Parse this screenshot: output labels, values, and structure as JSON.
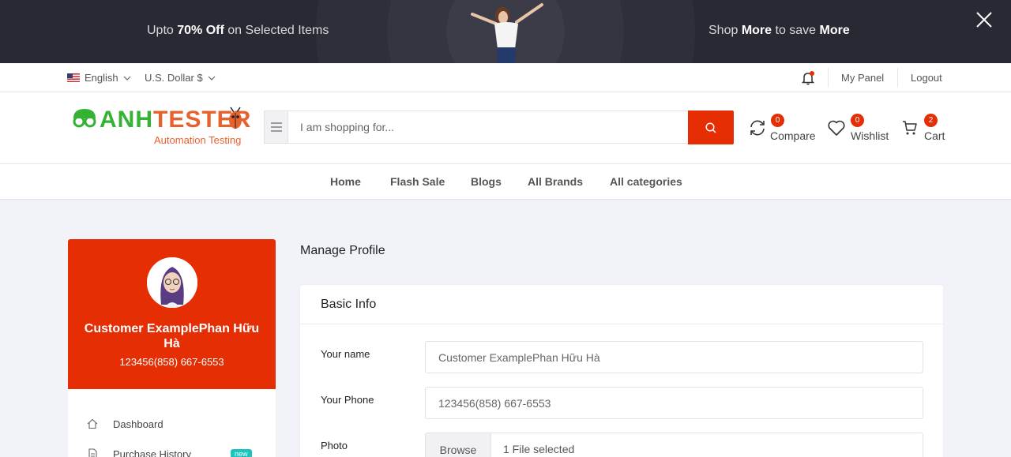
{
  "promo": {
    "left_pre": "Upto ",
    "left_bold": "70% Off",
    "left_post": " on Selected Items",
    "right_pre": "Shop ",
    "right_bold1": "More",
    "right_mid": " to save ",
    "right_bold2": "More"
  },
  "topbar": {
    "language": "English",
    "currency": "U.S. Dollar $",
    "my_panel": "My Panel",
    "logout": "Logout"
  },
  "header": {
    "logo_text_green": "ANH",
    "logo_text_orange": "TESTER",
    "logo_sub": "Automation Testing",
    "search_placeholder": "I am shopping for...",
    "compare_label": "Compare",
    "compare_count": "0",
    "wishlist_label": "Wishlist",
    "wishlist_count": "0",
    "cart_label": "Cart",
    "cart_count": "2"
  },
  "nav": {
    "items": [
      "Home",
      "Flash Sale",
      "Blogs",
      "All Brands",
      "All categories"
    ]
  },
  "sidebar": {
    "name": "Customer ExamplePhan Hữu Hà",
    "phone": "123456(858) 667-6553",
    "items": [
      {
        "label": "Dashboard",
        "icon": "home-icon"
      },
      {
        "label": "Purchase History",
        "icon": "document-icon",
        "badge": "new"
      }
    ]
  },
  "main": {
    "title": "Manage Profile",
    "panel_title": "Basic Info",
    "fields": [
      {
        "label": "Your name",
        "value": "Customer ExamplePhan Hữu Hà"
      },
      {
        "label": "Your Phone",
        "value": "123456(858) 667-6553"
      },
      {
        "label": "Photo",
        "browse": "Browse",
        "value": "1 File selected"
      }
    ]
  },
  "colors": {
    "accent": "#e62e04",
    "promo_bg": "#292933",
    "page_bg": "#f2f3f8"
  }
}
